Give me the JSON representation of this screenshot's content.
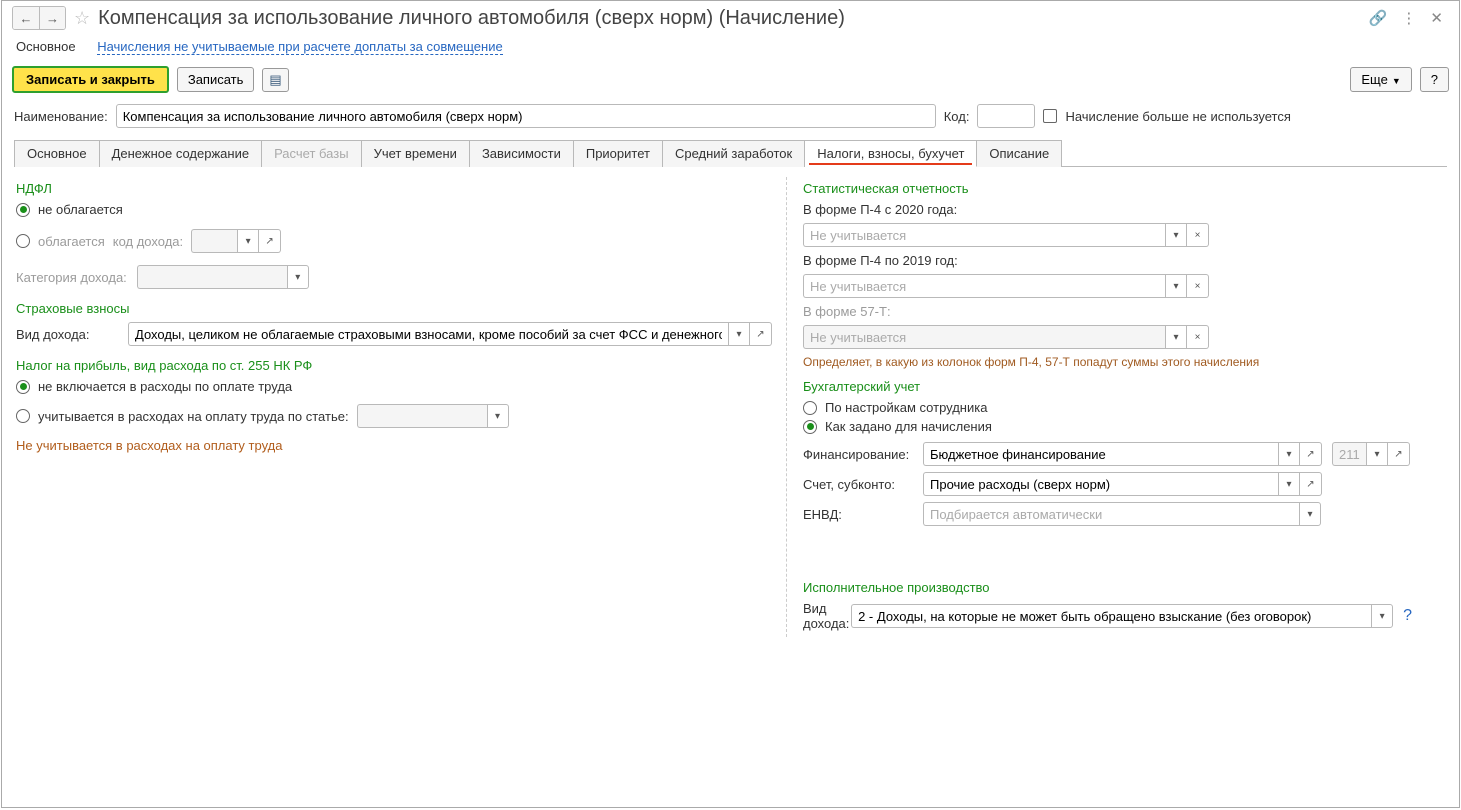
{
  "title": "Компенсация за использование личного автомобиля (сверх норм) (Начисление)",
  "subnav": {
    "main": "Основное",
    "link": "Начисления не учитываемые при расчете доплаты за совмещение"
  },
  "toolbar": {
    "save_close": "Записать и закрыть",
    "save": "Записать",
    "more": "Еще",
    "help": "?"
  },
  "name_label": "Наименование:",
  "name_value": "Компенсация за использование личного автомобиля (сверх норм)",
  "code_label": "Код:",
  "code_value": "",
  "not_used_label": "Начисление больше не используется",
  "tabs": {
    "t1": "Основное",
    "t2": "Денежное содержание",
    "t3": "Расчет базы",
    "t4": "Учет времени",
    "t5": "Зависимости",
    "t6": "Приоритет",
    "t7": "Средний заработок",
    "t8": "Налоги, взносы, бухучет",
    "t9": "Описание"
  },
  "left": {
    "ndfl_title": "НДФЛ",
    "ndfl_no": "не облагается",
    "ndfl_yes": "облагается",
    "income_code_label": "код дохода:",
    "income_cat_label": "Категория дохода:",
    "insurance_title": "Страховые взносы",
    "income_type_label": "Вид дохода:",
    "income_type_value": "Доходы, целиком не облагаемые страховыми взносами, кроме пособий за счет ФСС и денежного",
    "profit_tax_title": "Налог на прибыль, вид расхода по ст. 255 НК РФ",
    "profit_no": "не включается в расходы по оплате труда",
    "profit_yes": "учитывается в расходах на оплату труда по статье:",
    "note": "Не учитывается в расходах на оплату труда"
  },
  "right": {
    "stat_title": "Статистическая отчетность",
    "p4_2020_label": "В форме П-4 с 2020 года:",
    "p4_2019_label": "В форме П-4 по 2019 год:",
    "f57t_label": "В форме 57-Т:",
    "not_counted": "Не учитывается",
    "stat_hint": "Определяет, в какую из колонок форм П-4, 57-Т попадут суммы этого начисления",
    "acc_title": "Бухгалтерский учет",
    "acc_r1": "По настройкам сотрудника",
    "acc_r2": "Как задано для начисления",
    "fin_label": "Финансирование:",
    "fin_value": "Бюджетное финансирование",
    "fin_code": "211",
    "acct_label": "Счет, субконто:",
    "acct_value": "Прочие расходы (сверх норм)",
    "envd_label": "ЕНВД:",
    "envd_placeholder": "Подбирается автоматически",
    "exec_title": "Исполнительное производство",
    "exec_label": "Вид дохода:",
    "exec_value": "2 - Доходы, на которые не может быть обращено взыскание (без оговорок)"
  }
}
